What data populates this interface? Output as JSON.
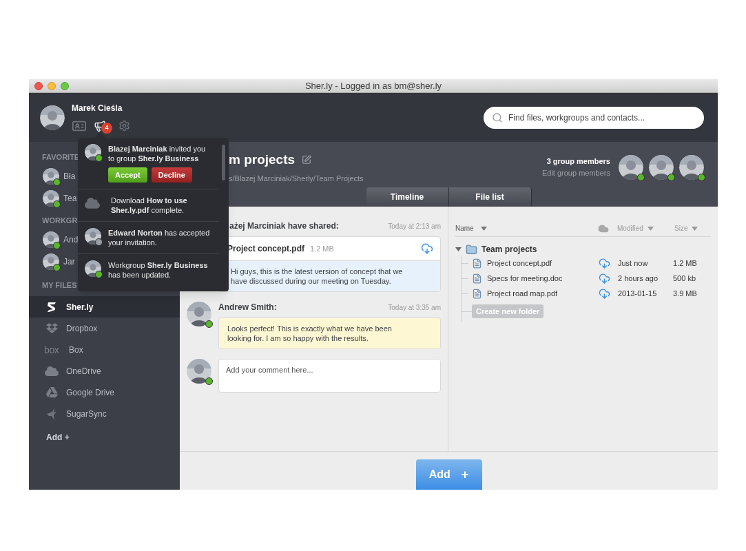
{
  "window": {
    "title": "Sher.ly - Logged in as bm@sher.ly"
  },
  "user": {
    "name": "Marek Cieśla",
    "notification_count": "4"
  },
  "search": {
    "placeholder": "Find files, workgroups and contacts..."
  },
  "sidebar": {
    "sections": [
      {
        "title": "FAVORITE",
        "items": [
          {
            "label": "Bła",
            "online": true
          },
          {
            "label": "Tea",
            "online": true
          }
        ]
      },
      {
        "title": "WORKGR",
        "items": [
          {
            "label": "And",
            "online": true
          },
          {
            "label": "Jar",
            "online": true
          }
        ]
      }
    ],
    "files_title": "MY FILES",
    "files": [
      {
        "kind": "sherly",
        "label": "Sher.ly",
        "selected": true
      },
      {
        "kind": "dropbox",
        "label": "Dropbox",
        "selected": false
      },
      {
        "kind": "box",
        "logo": "box",
        "label": "Box",
        "selected": false
      },
      {
        "kind": "onedrive",
        "label": "OneDrive",
        "selected": false
      },
      {
        "kind": "gdrive",
        "label": "Google Drive",
        "selected": false
      },
      {
        "kind": "sugarsync",
        "label": "SugarSync",
        "selected": false
      }
    ],
    "add": "Add +"
  },
  "notifications": [
    {
      "kind": "person",
      "online": true,
      "text": "**Blazej Marciniak** invited you to group **Sher.ly Business**",
      "actions": [
        {
          "kind": "accept",
          "label": "Accept"
        },
        {
          "kind": "decline",
          "label": "Decline"
        }
      ]
    },
    {
      "kind": "download",
      "text": "Download **How to use Sher.ly.pdf** complete."
    },
    {
      "kind": "person",
      "online": false,
      "text": "**Edward Norton** has accepted your invitation."
    },
    {
      "kind": "person",
      "online": true,
      "text": "Workgroup **Sher.ly Business** has been updated."
    }
  ],
  "group": {
    "title": "m projects",
    "path": "s/Blazej Marciniak/Sherly/Team Projects",
    "members_count": "3 group members",
    "edit_link": "Edit group members",
    "members": [
      {
        "online": true
      },
      {
        "online": true
      },
      {
        "online": true
      }
    ]
  },
  "tabs": [
    {
      "label": "Timeline"
    },
    {
      "label": "File list"
    }
  ],
  "timeline": [
    {
      "author": "ażej Marciniak have shared:",
      "time": "Today at 2:13 am",
      "attachment": {
        "name": "Project concept.pdf",
        "size": "1.2 MB"
      },
      "body": "Hi guys, this is the latest version of concept that we have discussed during our meeting on Tuesday.",
      "color": "#e6f1fc"
    },
    {
      "author": "Andrew Smith:",
      "time": "Today at 3:35 am",
      "avatar": {
        "online": true
      },
      "body": "Looks perfect! This is exactly what we have been looking for. I am so happy with the results.",
      "color": "#fdf7d4"
    }
  ],
  "comment": {
    "placeholder": "Add your comment here...",
    "online": true
  },
  "file_list": {
    "columns": {
      "name": "Name",
      "modified": "Modified",
      "size": "Size"
    },
    "folder": {
      "name": "Team projects",
      "expanded": true,
      "children": [
        {
          "name": "Project concept.pdf",
          "modified": "Just now",
          "size": "1.2 MB"
        },
        {
          "name": "Specs for meeting.doc",
          "modified": "2 hours ago",
          "size": "500 kb"
        },
        {
          "name": "Project road map.pdf",
          "modified": "2013-01-15",
          "size": "3.9 MB"
        }
      ]
    },
    "create_folder": "Create new folder"
  },
  "add_button": {
    "label": "Add",
    "icon": "+"
  }
}
